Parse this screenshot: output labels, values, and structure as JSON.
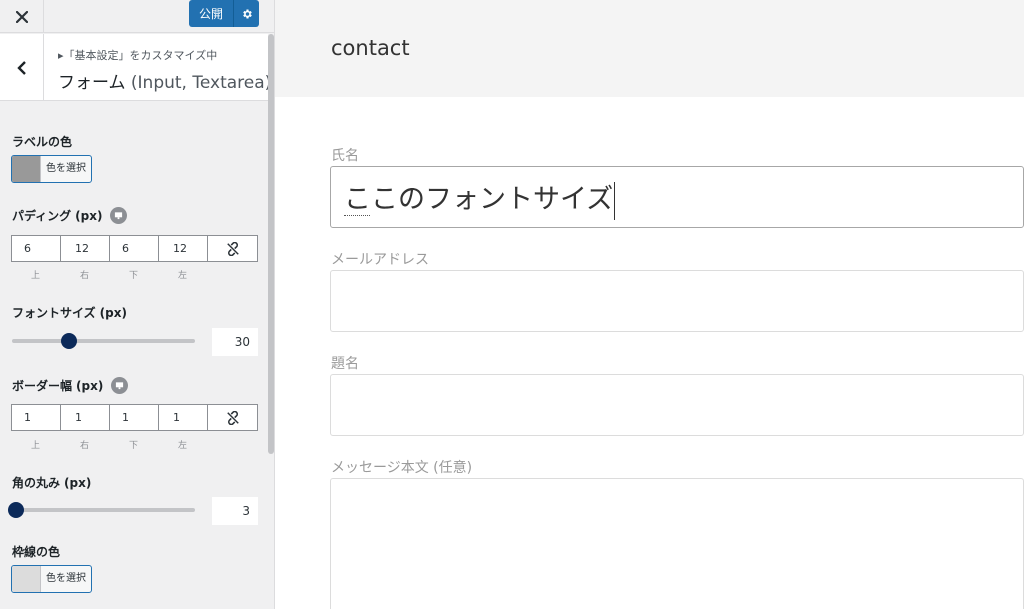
{
  "topbar": {
    "close_label": "×",
    "publish_label": "公開"
  },
  "section": {
    "breadcrumb": "▸「基本設定」をカスタマイズ中",
    "title": "フォーム",
    "title_sub": "(Input, Textarea)"
  },
  "controls": {
    "label_color": {
      "label": "ラベルの色",
      "button": "色を選択",
      "swatch": "#999999"
    },
    "padding": {
      "label": "パディング",
      "unit": "(px)",
      "values": [
        "6",
        "12",
        "6",
        "12"
      ],
      "sides": [
        "上",
        "右",
        "下",
        "左"
      ]
    },
    "font_size": {
      "label": "フォントサイズ",
      "unit": "(px)",
      "value": "30",
      "fraction": 0.29
    },
    "border_width": {
      "label": "ボーダー幅",
      "unit": "(px)",
      "values": [
        "1",
        "1",
        "1",
        "1"
      ],
      "sides": [
        "上",
        "右",
        "下",
        "左"
      ]
    },
    "radius": {
      "label": "角の丸み",
      "unit": "(px)",
      "value": "3",
      "fraction": 0.0
    },
    "border_color": {
      "label": "枠線の色",
      "button": "色を選択",
      "swatch": "#dcdcdc"
    }
  },
  "preview": {
    "page_title": "contact",
    "fields": [
      {
        "label": "氏名",
        "value": "ここのフォントサイズ"
      },
      {
        "label": "メールアドレス",
        "value": ""
      },
      {
        "label": "題名",
        "value": ""
      },
      {
        "label": "メッセージ本文 (任意)",
        "value": ""
      }
    ]
  },
  "colors": {
    "accent": "#2271b1",
    "thumb": "#0c2a5a"
  }
}
